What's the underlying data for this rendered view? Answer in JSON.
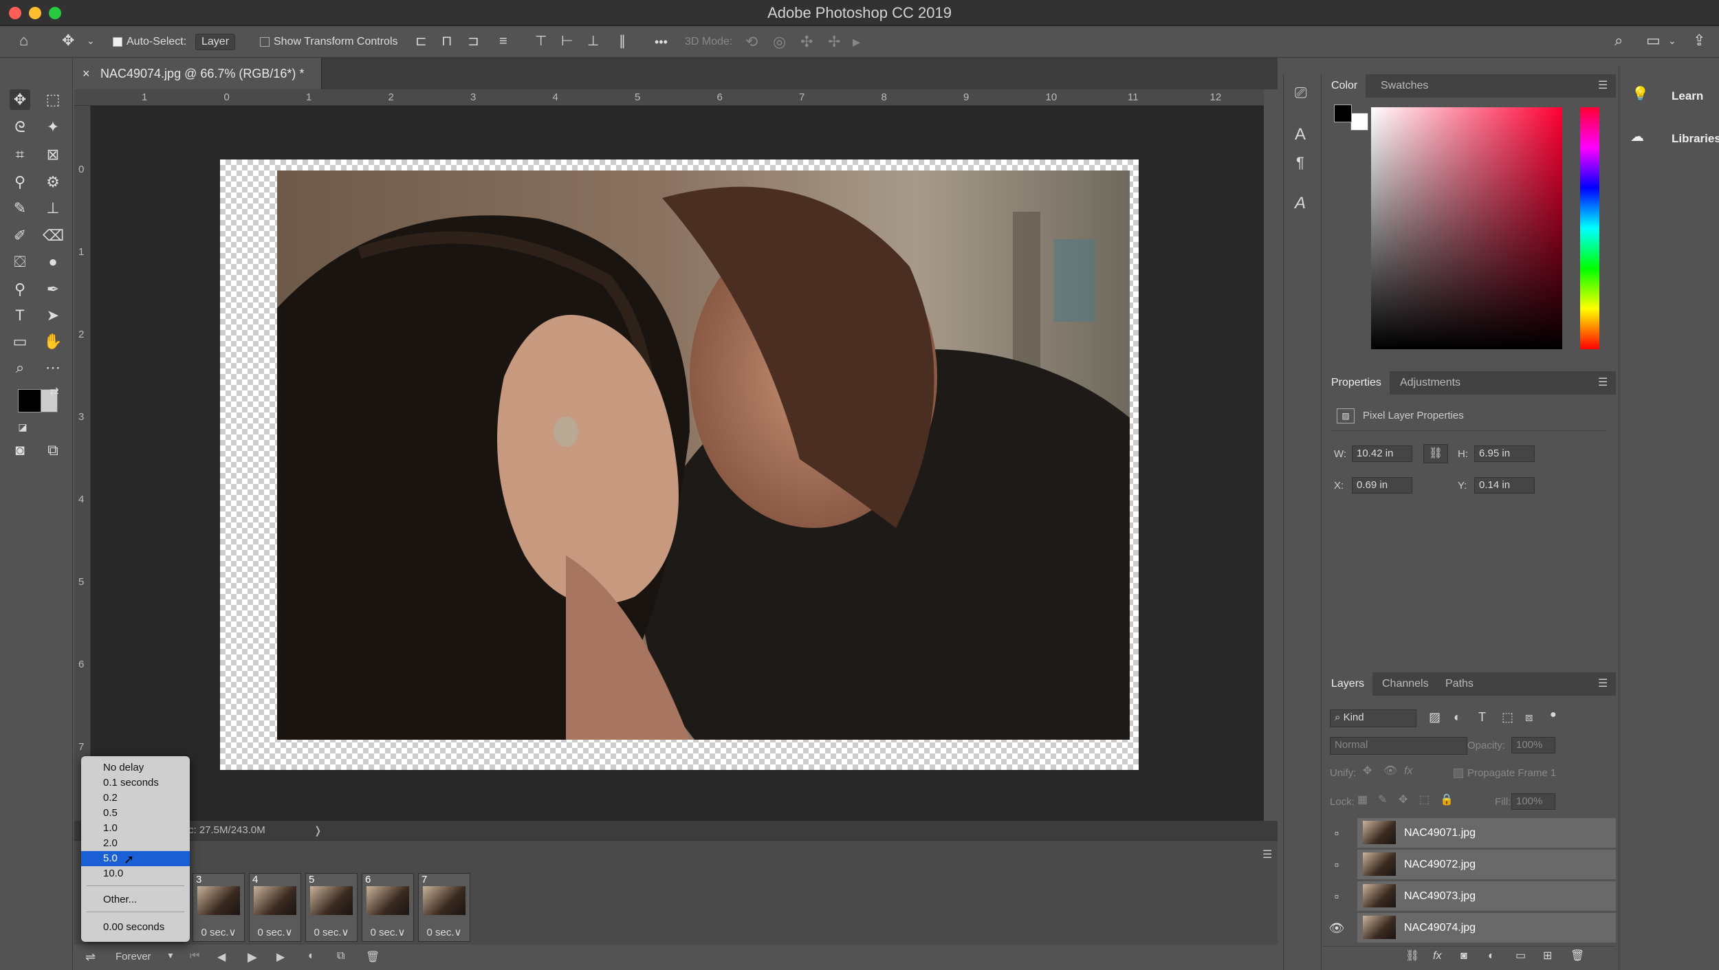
{
  "app": {
    "title": "Adobe Photoshop CC 2019"
  },
  "options_bar": {
    "auto_select_label": "Auto-Select:",
    "auto_select_value": "Layer",
    "show_transform_label": "Show Transform Controls",
    "more": "•••",
    "mode_3d": "3D Mode:"
  },
  "document": {
    "tab_title": "NAC49074.jpg @ 66.7% (RGB/16*) *",
    "close": "×"
  },
  "ruler_h": [
    "1",
    "0",
    "1",
    "2",
    "3",
    "4",
    "5",
    "6",
    "7",
    "8",
    "9",
    "10",
    "11",
    "12"
  ],
  "ruler_v": [
    "0",
    "1",
    "2",
    "3",
    "4",
    "5",
    "6",
    "7"
  ],
  "status": {
    "doc_size": "c: 27.5M/243.0M",
    "arrow": "❭"
  },
  "timeline": {
    "frames": [
      {
        "num": "3",
        "delay": "0 sec.∨"
      },
      {
        "num": "4",
        "delay": "0 sec.∨"
      },
      {
        "num": "5",
        "delay": "0 sec.∨"
      },
      {
        "num": "6",
        "delay": "0 sec.∨"
      },
      {
        "num": "7",
        "delay": "0 sec.∨"
      }
    ],
    "loop": "Forever",
    "delay_menu": [
      "No delay",
      "0.1 seconds",
      "0.2",
      "0.5",
      "1.0",
      "2.0",
      "5.0",
      "10.0"
    ],
    "delay_other": "Other...",
    "delay_current": "0.00 seconds",
    "selected_index": 6
  },
  "color_panel": {
    "tabs": [
      "Color",
      "Swatches"
    ]
  },
  "properties": {
    "tabs": [
      "Properties",
      "Adjustments"
    ],
    "kind": "Pixel Layer Properties",
    "w_label": "W:",
    "w": "10.42 in",
    "h_label": "H:",
    "h": "6.95 in",
    "x_label": "X:",
    "x": "0.69 in",
    "y_label": "Y:",
    "y": "0.14 in"
  },
  "layers": {
    "tabs": [
      "Layers",
      "Channels",
      "Paths"
    ],
    "filter": "Kind",
    "blend": "Normal",
    "opacity_label": "Opacity:",
    "opacity": "100%",
    "unify_label": "Unify:",
    "propagate": "Propagate Frame 1",
    "lock_label": "Lock:",
    "fill_label": "Fill:",
    "fill": "100%",
    "items": [
      {
        "name": "NAC49071.jpg",
        "visible": false
      },
      {
        "name": "NAC49072.jpg",
        "visible": false
      },
      {
        "name": "NAC49073.jpg",
        "visible": false
      },
      {
        "name": "NAC49074.jpg",
        "visible": true
      }
    ]
  },
  "learn_panel": {
    "learn": "Learn",
    "libraries": "Libraries"
  },
  "colors": {
    "accent": "#1a5fd4",
    "fg": "#000000",
    "bg": "#ffffff"
  }
}
